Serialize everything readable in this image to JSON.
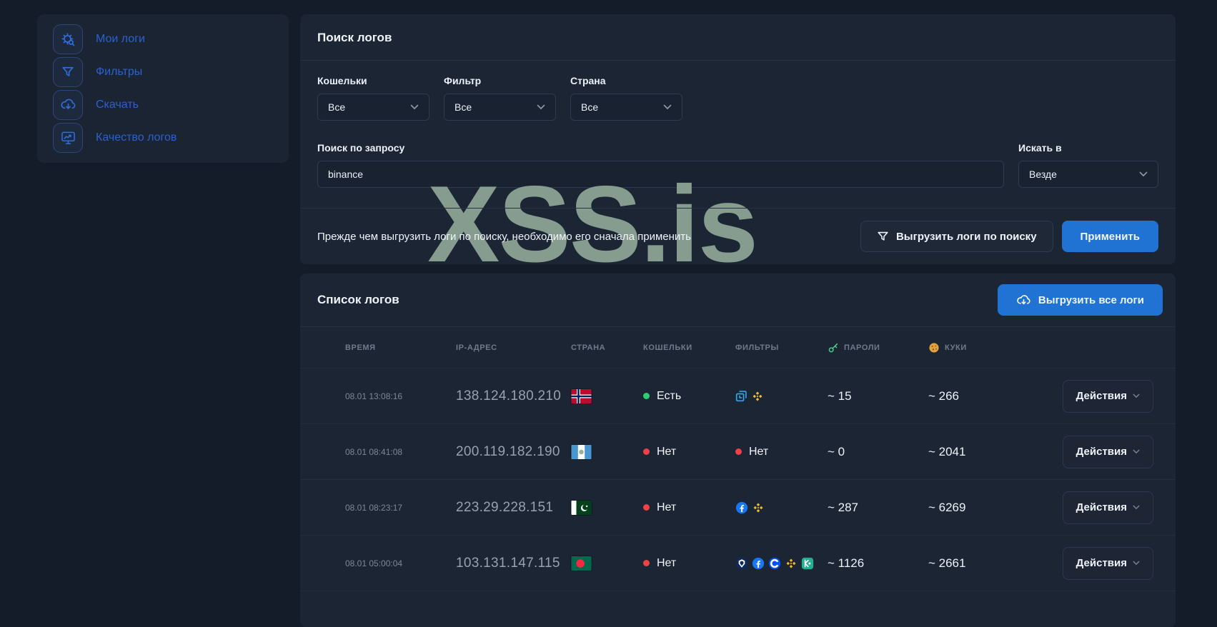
{
  "watermark": "XSS.is",
  "colors": {
    "page_bg": "#151c29",
    "card_bg": "#1c2533",
    "accent_blue": "#2173d3",
    "sidebar_link_blue": "#2b61cc",
    "status_green": "#2ecc71",
    "status_red": "#ef4146",
    "watermark_green": "#8ba394",
    "binance_yellow": "#f3ba2f",
    "key_green": "#3fd68f",
    "cookie_orange": "#e2a23b"
  },
  "sidebar": {
    "items": [
      {
        "label": "Мои логи",
        "icon": "malware-search-icon"
      },
      {
        "label": "Фильтры",
        "icon": "filter-icon"
      },
      {
        "label": "Скачать",
        "icon": "cloud-download-icon"
      },
      {
        "label": "Качество логов",
        "icon": "monitor-chart-icon"
      }
    ]
  },
  "search_panel": {
    "title": "Поиск логов",
    "filters": [
      {
        "label": "Кошельки",
        "value": "Все"
      },
      {
        "label": "Фильтр",
        "value": "Все"
      },
      {
        "label": "Страна",
        "value": "Все"
      }
    ],
    "query": {
      "label": "Поиск по запросу",
      "value": "binance"
    },
    "scope": {
      "label": "Искать в",
      "value": "Везде"
    },
    "notice": "Прежде чем выгрузить логи по поиску, необходимо его сначала применить",
    "export_search_button": "Выгрузить логи по поиску",
    "apply_button": "Применить"
  },
  "logs_panel": {
    "title": "Список логов",
    "export_all_button": "Выгрузить все логи",
    "actions_button": "Действия",
    "columns": [
      {
        "label": "ВРЕМЯ"
      },
      {
        "label": "IP-АДРЕС"
      },
      {
        "label": "СТРАНА"
      },
      {
        "label": "КОШЕЛЬКИ"
      },
      {
        "label": "ФИЛЬТРЫ"
      },
      {
        "label": "ПАРОЛИ",
        "icon": "key-icon"
      },
      {
        "label": "КУКИ",
        "icon": "cookie-icon"
      }
    ],
    "rows": [
      {
        "time": "08.01 13:08:16",
        "ip": "138.124.180.210",
        "country": "norway",
        "wallets": {
          "status": "yes",
          "label": "Есть"
        },
        "filters": {
          "icons": [
            "app-window-icon",
            "binance-icon"
          ]
        },
        "passwords": "~ 15",
        "cookies": "~ 266"
      },
      {
        "time": "08.01 08:41:08",
        "ip": "200.119.182.190",
        "country": "guatemala",
        "wallets": {
          "status": "no",
          "label": "Нет"
        },
        "filters": {
          "status": "no",
          "label": "Нет"
        },
        "passwords": "~ 0",
        "cookies": "~ 2041"
      },
      {
        "time": "08.01 08:23:17",
        "ip": "223.29.228.151",
        "country": "pakistan",
        "wallets": {
          "status": "no",
          "label": "Нет"
        },
        "filters": {
          "icons": [
            "facebook-icon",
            "binance-icon"
          ]
        },
        "passwords": "~ 287",
        "cookies": "~ 6269"
      },
      {
        "time": "08.01 05:00:04",
        "ip": "103.131.147.115",
        "country": "bangladesh",
        "wallets": {
          "status": "no",
          "label": "Нет"
        },
        "filters": {
          "icons": [
            "cryptocom-icon",
            "facebook-icon",
            "coinbase-icon",
            "binance-icon",
            "kucoin-icon"
          ]
        },
        "passwords": "~ 1126",
        "cookies": "~ 2661"
      }
    ]
  }
}
